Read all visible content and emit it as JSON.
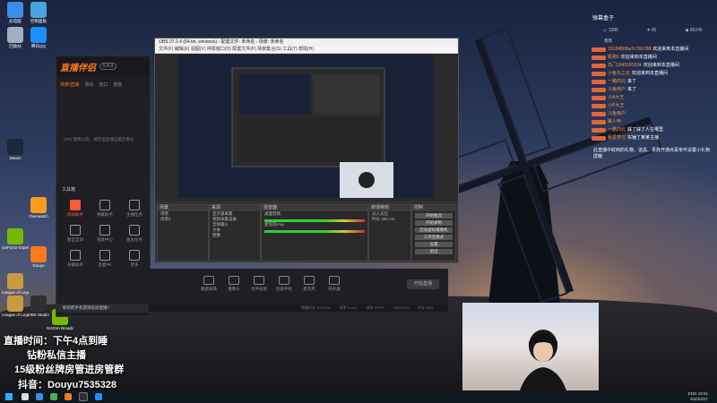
{
  "desktop_icons": [
    {
      "label": "此电脑",
      "color": "#3a8ee6"
    },
    {
      "label": "控制面板",
      "color": "#4aa3df"
    },
    {
      "label": "回收站",
      "color": "#9fb0c0"
    },
    {
      "label": "腾讯QQ",
      "color": "#1e90ff"
    },
    {
      "label": "Steam",
      "color": "#1b2838"
    },
    {
      "label": "GeForce Experience",
      "color": "#76b900"
    },
    {
      "label": "Overwatch",
      "color": "#f99e1a"
    },
    {
      "label": "League of Legends",
      "color": "#c89b3c"
    },
    {
      "label": "League of Legends",
      "color": "#c89b3c"
    },
    {
      "label": "Douyu",
      "color": "#ff7a1a"
    },
    {
      "label": "OBS Studio",
      "color": "#302e31"
    },
    {
      "label": "NVIDIA Broadcast",
      "color": "#76b900"
    }
  ],
  "obs": {
    "title": "OBS 27.2.4 (64-bit, windows) - 配置文件: 未命名 - 场景: 未命名",
    "menu": "文件(F)  编辑(E)  视图(V)  停靠窗口(D)  配置文件(P)  场景集合(S)  工具(T)  帮助(H)",
    "docks": {
      "scenes": "场景",
      "sources": "来源",
      "mixer": "混音器",
      "transitions": "转场特效",
      "controls": "控制"
    },
    "scene_items": [
      "场景",
      "场景2"
    ],
    "source_items": [
      "显示器采集",
      "视频采集设备",
      "音频输入",
      "文本",
      "图像"
    ],
    "mixer_items": [
      "桌面音频",
      "麦克风/Aux"
    ],
    "transition_labels": [
      "淡入淡出",
      "时长 300 ms"
    ],
    "control_buttons": [
      "开始推流",
      "开始录制",
      "启动虚拟摄像机",
      "工作室模式",
      "设置",
      "退出"
    ]
  },
  "douyu": {
    "logo": "直播伴侣",
    "version": "5.4.3",
    "tabs": [
      "场景/直播",
      "游戏",
      "窗口",
      "摄像"
    ],
    "hint": "CPU 使用过高，请检查直播设置后重试",
    "tools_title": "工具箱",
    "tools": [
      "房间助手",
      "弹幕助手",
      "主播任务",
      "粉丝互动",
      "道具中心",
      "鱼丸任务",
      "开箱助手",
      "连麦PK",
      "更多"
    ],
    "notice": "如何把手机游戏投屏直播?",
    "bottom_buttons": [
      "截图录像",
      "摄像头",
      "文件投屏",
      "连接手机",
      "麦克风",
      "扬声器"
    ],
    "start_button": "开始直播",
    "status": [
      "直播时长 00:00:00",
      "码率 0 kb/s",
      "帧率 0 FPS",
      "CPU 21%",
      "内存 45%"
    ]
  },
  "chat": {
    "title": "弹幕盒子",
    "stats": [
      "1586",
      "45",
      "85245"
    ],
    "subheader": "贵宾",
    "messages": [
      {
        "name": "1518486fba7c7b5788",
        "text": "欢迎来到本直播间"
      },
      {
        "name": "昵称6",
        "text": "欢迎来到本直播间"
      },
      {
        "name": "鸟门1845181634",
        "text": "欢迎来到本直播间"
      },
      {
        "name": "小鱼丸之北",
        "text": "欢迎来到本直播间"
      },
      {
        "name": "一路向北",
        "text": "来了"
      },
      {
        "name": "斗鱼用户",
        "text": "来了"
      },
      {
        "name": "小A大王",
        "text": ""
      },
      {
        "name": "小P大王",
        "text": ""
      },
      {
        "name": "斗鱼用户",
        "text": ""
      },
      {
        "name": "路人甲",
        "text": ""
      },
      {
        "name": "一路向北",
        "text": "踩了踩了人在哪里"
      },
      {
        "name": "我爱学习",
        "text": "实锤了某某主播"
      }
    ],
    "gift_note": "此直播中收到的礼物、道具、贵族开通点喜单可设置小礼物屏蔽"
  },
  "overlay": {
    "line1": "直播时间：下午4点到睡",
    "line2": "钻粉私信主播",
    "line3": "15级粉丝牌房管进房管群",
    "line4": "抖音：Douyu7535328"
  },
  "tray": {
    "time": "19:51",
    "date": "2022/2/27",
    "lang": "ENG"
  }
}
